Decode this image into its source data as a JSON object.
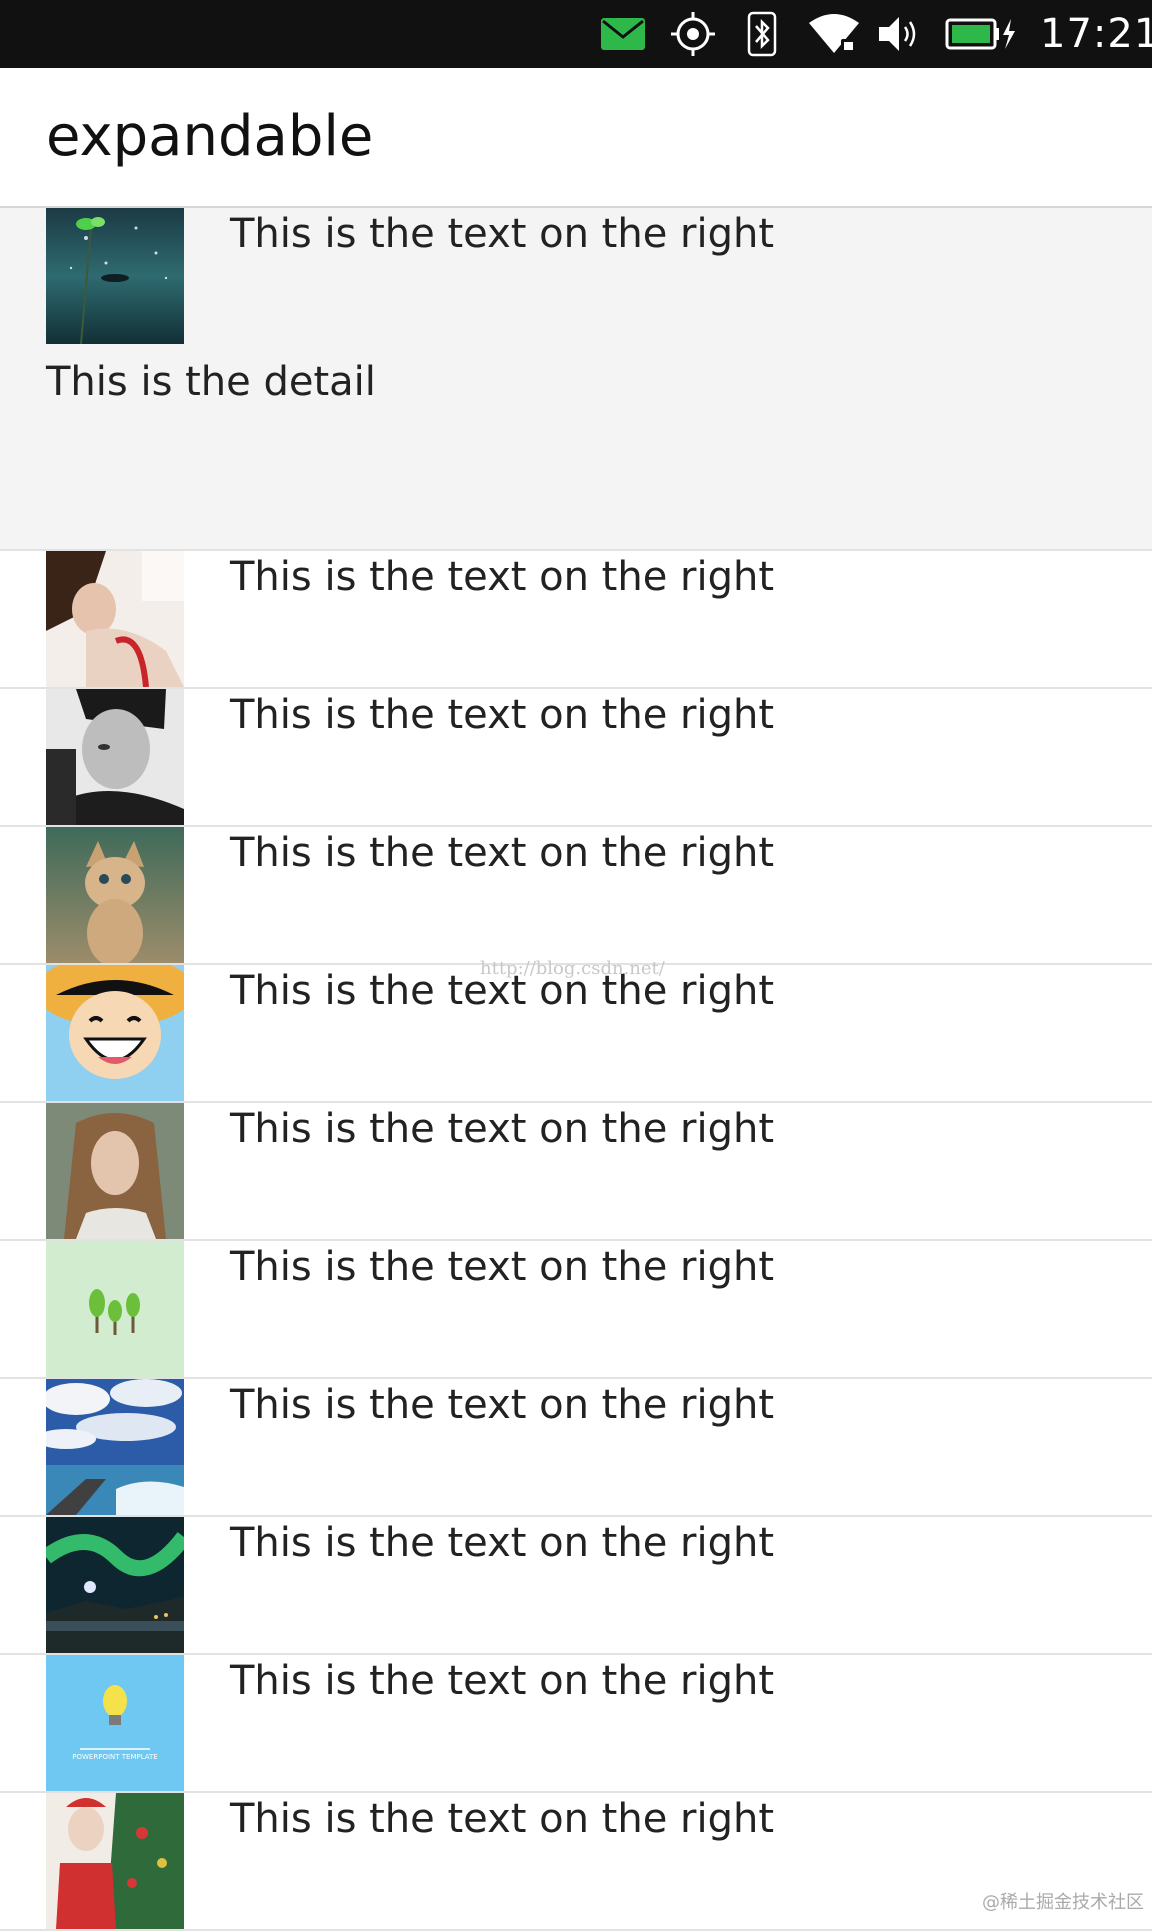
{
  "status_bar": {
    "time": "17:21",
    "icons": [
      "mail-icon",
      "location-icon",
      "bluetooth-icon",
      "wifi-icon",
      "volume-icon",
      "battery-charging-icon"
    ],
    "mail_color": "#2fb84a",
    "battery_color": "#2fb84a"
  },
  "header": {
    "title": "expandable"
  },
  "list": {
    "expanded_detail": "This is the detail",
    "items": [
      {
        "text": "This is the text on the right",
        "thumbnail": "plant-water"
      },
      {
        "text": "This is the text on the right",
        "thumbnail": "woman-red"
      },
      {
        "text": "This is the text on the right",
        "thumbnail": "man-bw"
      },
      {
        "text": "This is the text on the right",
        "thumbnail": "kitten"
      },
      {
        "text": "This is the text on the right",
        "thumbnail": "cartoon-straw-hat"
      },
      {
        "text": "This is the text on the right",
        "thumbnail": "long-hair-portrait"
      },
      {
        "text": "This is the text on the right",
        "thumbnail": "green-trees"
      },
      {
        "text": "This is the text on the right",
        "thumbnail": "sky-pier"
      },
      {
        "text": "This is the text on the right",
        "thumbnail": "aurora"
      },
      {
        "text": "This is the text on the right",
        "thumbnail": "lightbulb-template"
      },
      {
        "text": "This is the text on the right",
        "thumbnail": "christmas-girl"
      }
    ],
    "bulb_template_caption": "POWERPOINT TEMPLATE"
  },
  "watermark": {
    "url": "http://blog.csdn.net/",
    "corner": "@稀土掘金技术社区"
  }
}
